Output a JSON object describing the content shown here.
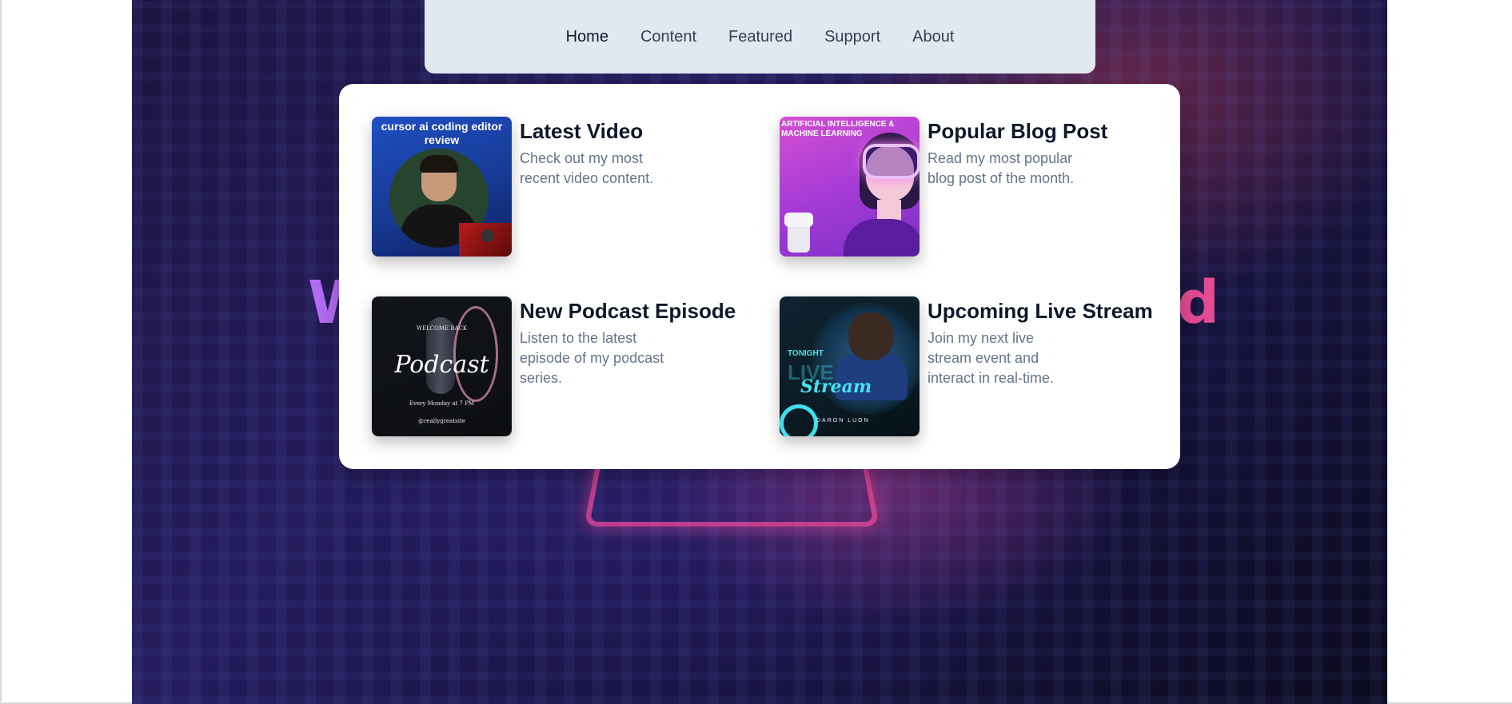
{
  "nav": {
    "items": [
      {
        "label": "Home",
        "active": true
      },
      {
        "label": "Content",
        "active": false
      },
      {
        "label": "Featured",
        "active": false
      },
      {
        "label": "Support",
        "active": false
      },
      {
        "label": "About",
        "active": false
      }
    ]
  },
  "hero": {
    "title_left_fragment": "W",
    "title_right_fragment": "d"
  },
  "cards": [
    {
      "title": "Latest Video",
      "description": "Check out my most recent video content.",
      "thumbnail_caption": "cursor ai coding editor review",
      "thumbnail_icon": "video-thumbnail-icon"
    },
    {
      "title": "Popular Blog Post",
      "description": "Read my most popular blog post of the month.",
      "thumbnail_caption": "Artificial Intelligence & Machine Learning",
      "thumbnail_icon": "blog-thumbnail-icon"
    },
    {
      "title": "New Podcast Episode",
      "description": "Listen to the latest episode of my podcast series.",
      "thumbnail_caption": "Podcast",
      "thumbnail_small_top": "WELCOME BACK",
      "thumbnail_small_mid": "Every Monday at 7 PM",
      "thumbnail_small_bottom": "@reallygreatsite",
      "thumbnail_icon": "podcast-thumbnail-icon"
    },
    {
      "title": "Upcoming Live Stream",
      "description": "Join my next live stream event and interact in real-time.",
      "thumbnail_tonight": "TONIGHT",
      "thumbnail_live": "LIVE",
      "thumbnail_stream": "Stream",
      "thumbnail_name": "DARON LUON",
      "thumbnail_icon": "live-stream-thumbnail-icon"
    }
  ],
  "colors": {
    "nav_bg": "#e2e8f0",
    "card_title": "#0f172a",
    "card_desc": "#64748b",
    "hero_title_left": "#b46cf2",
    "hero_title_right": "#e64a93"
  }
}
